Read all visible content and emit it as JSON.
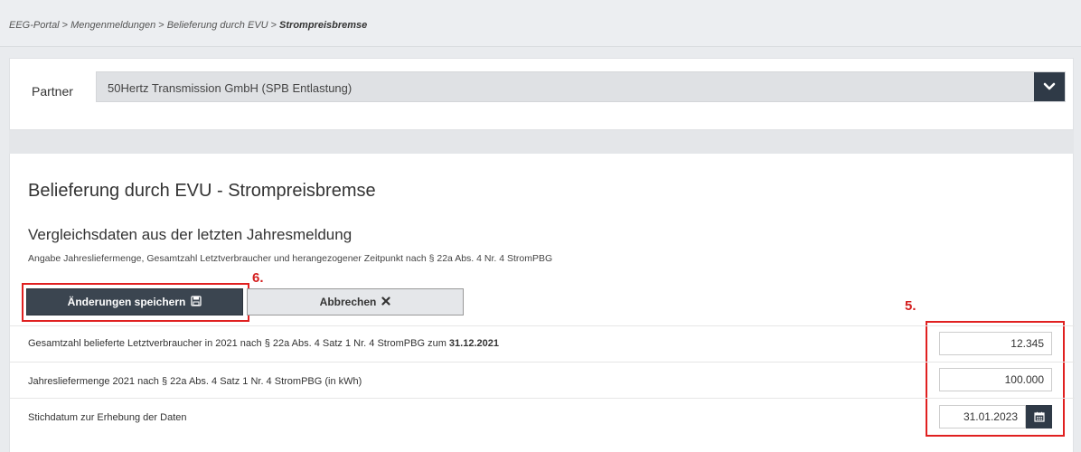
{
  "breadcrumb": {
    "items": [
      "EEG-Portal",
      "Mengenmeldungen",
      "Belieferung durch EVU"
    ],
    "current": "Strompreisbremse",
    "separator": ">"
  },
  "partner": {
    "label": "Partner",
    "selected": "50Hertz Transmission GmbH (SPB Entlastung)"
  },
  "page": {
    "title": "Belieferung durch EVU - Strompreisbremse",
    "section_title": "Vergleichsdaten aus der letzten Jahresmeldung",
    "section_desc": "Angabe Jahresliefermenge, Gesamtzahl Letztverbraucher und herangezogener Zeitpunkt nach § 22a Abs. 4 Nr. 4 StromPBG"
  },
  "buttons": {
    "save_label": "Änderungen speichern",
    "cancel_label": "Abbrechen"
  },
  "annotations": {
    "save_marker": "6.",
    "fields_marker": "5.",
    "color": "#e02020"
  },
  "fields": {
    "consumers_label": "Gesamtzahl belieferte Letztverbraucher in 2021 nach § 22a Abs. 4 Satz 1 Nr. 4 StromPBG zum ",
    "consumers_date": "31.12.2021",
    "consumers_value": "12.345",
    "quantity_label": "Jahresliefermenge 2021 nach § 22a Abs. 4 Satz 1 Nr. 4 StromPBG (in kWh)",
    "quantity_value": "100.000",
    "date_label": "Stichdatum zur Erhebung der Daten",
    "date_value": "31.01.2023"
  },
  "icons": {
    "dropdown": "chevron-down-icon",
    "save": "floppy-disk-icon",
    "cancel": "close-icon",
    "calendar": "calendar-icon"
  },
  "colors": {
    "dark_button": "#3b4550",
    "accent_dark": "#2f3a47"
  }
}
